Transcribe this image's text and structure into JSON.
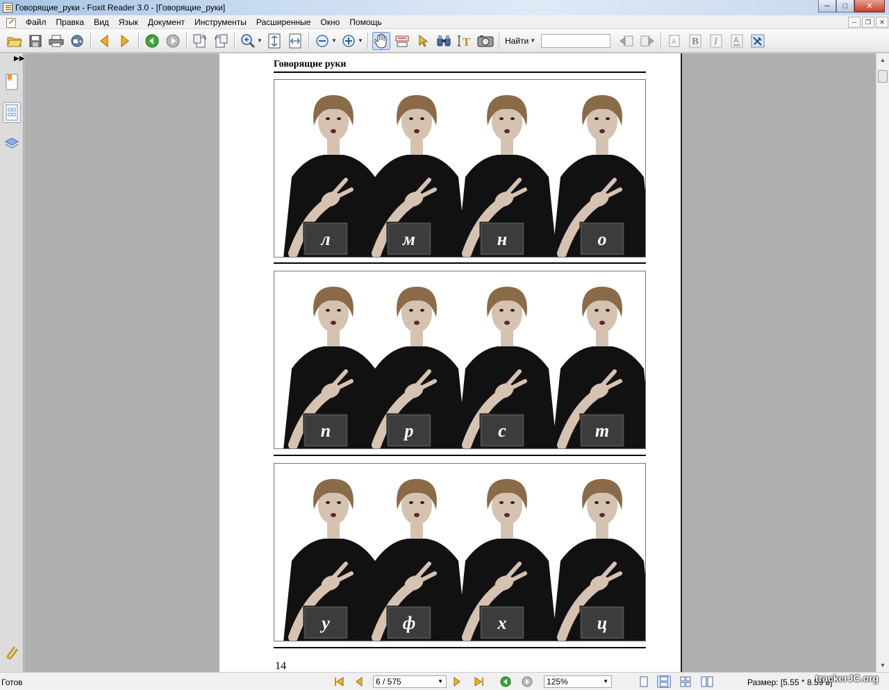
{
  "window": {
    "title": "Говорящие_руки - Foxit Reader 3.0 - [Говорящие_руки]",
    "controls": [
      "minimize",
      "maximize",
      "close"
    ]
  },
  "menu": {
    "items": [
      "Файл",
      "Правка",
      "Вид",
      "Язык",
      "Документ",
      "Инструменты",
      "Расширенные",
      "Окно",
      "Помощь"
    ]
  },
  "toolbar": {
    "find_label": "Найти",
    "find_value": "",
    "icons": [
      "open-folder-icon",
      "save-icon",
      "print-icon",
      "email-icon",
      "previous-page-icon",
      "next-page-icon",
      "go-back-icon",
      "go-forward-icon",
      "rotate-left-icon",
      "rotate-right-icon",
      "zoom-in-icon",
      "fit-page-icon",
      "fit-width-icon",
      "zoom-out-icon",
      "zoom-plus-icon",
      "hand-tool-icon",
      "select-text-icon",
      "select-arrow-icon",
      "find-binoculars-icon",
      "typewriter-icon",
      "snapshot-icon",
      "find-previous-icon",
      "find-next-icon",
      "text-box-icon",
      "bold-icon",
      "italic-icon",
      "underline-icon",
      "settings-icon"
    ]
  },
  "leftnav": {
    "icons": [
      "bookmarks-icon",
      "page-thumbnails-icon",
      "layers-icon",
      "attachments-icon"
    ]
  },
  "document": {
    "running_head": "Говорящие руки",
    "page_number": "14",
    "rows": [
      {
        "letters": [
          "л",
          "м",
          "н",
          "о"
        ]
      },
      {
        "letters": [
          "п",
          "р",
          "с",
          "т"
        ]
      },
      {
        "letters": [
          "у",
          "ф",
          "х",
          "ц"
        ]
      }
    ]
  },
  "statusbar": {
    "status": "Готов",
    "page_field": "6 / 575",
    "zoom_field": "125%",
    "size": "Размер: [5.55 * 8.59 в]",
    "watermark": "trackerJC.org"
  },
  "colors": {
    "document_background": "#b0b0b0",
    "page": "#ffffff",
    "letter_box": "#3c3c3c",
    "shirt": "#111111",
    "hair": "#8a6a48",
    "skin": "#d6c2b0"
  }
}
